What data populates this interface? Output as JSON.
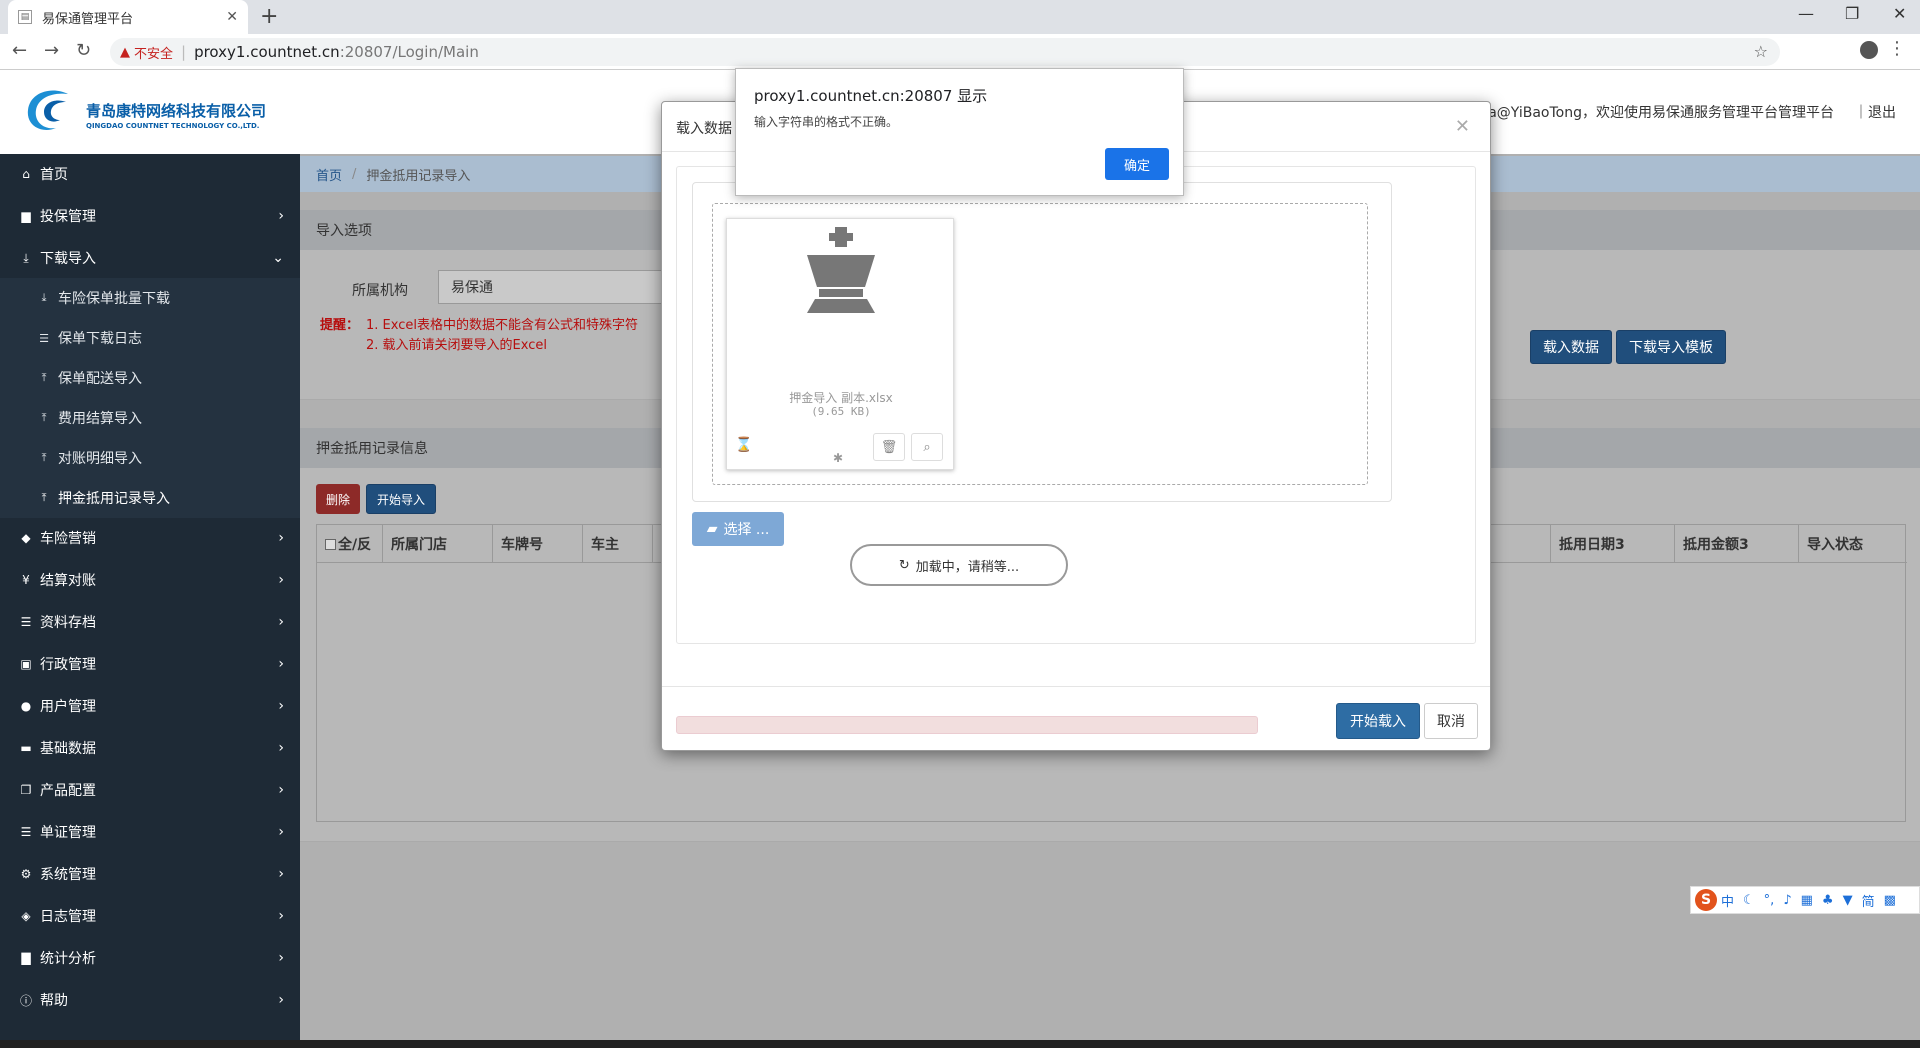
{
  "browser": {
    "tab_title": "易保通管理平台",
    "url_warning": "不安全",
    "url_host": "proxy1.countnet.cn",
    "url_path": ":20807/Login/Main"
  },
  "header": {
    "company_cn": "青岛康特网络科技有限公司",
    "company_en": "QINGDAO COUNTNET TECHNOLOGY CO.,LTD.",
    "welcome": "a@YiBaoTong，欢迎使用易保通服务管理平台管理平台",
    "logout": "｜退出"
  },
  "sidebar": {
    "items": [
      {
        "label": "首页",
        "icon": "home-icon"
      },
      {
        "label": "投保管理",
        "icon": "file-icon"
      },
      {
        "label": "下载导入",
        "icon": "download-icon"
      },
      {
        "label": "车险营销",
        "icon": "car-icon"
      },
      {
        "label": "结算对账",
        "icon": "yen-icon"
      },
      {
        "label": "资料存档",
        "icon": "list-icon"
      },
      {
        "label": "行政管理",
        "icon": "briefcase-icon"
      },
      {
        "label": "用户管理",
        "icon": "user-icon"
      },
      {
        "label": "基础数据",
        "icon": "hdd-icon"
      },
      {
        "label": "产品配置",
        "icon": "copy-icon"
      },
      {
        "label": "单证管理",
        "icon": "list-icon"
      },
      {
        "label": "系统管理",
        "icon": "gear-icon"
      },
      {
        "label": "日志管理",
        "icon": "tags-icon"
      },
      {
        "label": "统计分析",
        "icon": "chart-icon"
      },
      {
        "label": "帮助",
        "icon": "info-icon"
      }
    ],
    "subitems": [
      {
        "label": "车险保单批量下载"
      },
      {
        "label": "保单下载日志"
      },
      {
        "label": "保单配送导入"
      },
      {
        "label": "费用结算导入"
      },
      {
        "label": "对账明细导入"
      },
      {
        "label": "押金抵用记录导入"
      }
    ]
  },
  "breadcrumb": {
    "home": "首页",
    "current": "押金抵用记录导入"
  },
  "import_panel": {
    "title": "导入选项",
    "org_label": "所属机构",
    "org_value": "易保通",
    "tip_label": "提醒：",
    "tip1": "1. Excel表格中的数据不能含有公式和特殊字符",
    "tip2": "2. 载入前请关闭要导入的Excel",
    "load_btn": "载入数据",
    "template_btn": "下载导入模板"
  },
  "records_panel": {
    "title": "押金抵用记录信息",
    "delete_btn": "删除",
    "start_btn": "开始导入",
    "columns": [
      "全/反",
      "所属门店",
      "车牌号",
      "车主"
    ],
    "columns_right": [
      "抵用日期3",
      "抵用金额3",
      "导入状态"
    ]
  },
  "modal": {
    "title": "载入数据",
    "file_name": "押金导入 副本.xlsx",
    "file_size": "(9.65 KB)",
    "select_btn": "选择 ...",
    "loading_text": "加载中，请稍等...",
    "start_btn": "开始载入",
    "cancel_btn": "取消"
  },
  "alert": {
    "title": "proxy1.countnet.cn:20807 显示",
    "message": "输入字符串的格式不正确。",
    "ok": "确定"
  },
  "ime": {
    "lang": "中"
  }
}
